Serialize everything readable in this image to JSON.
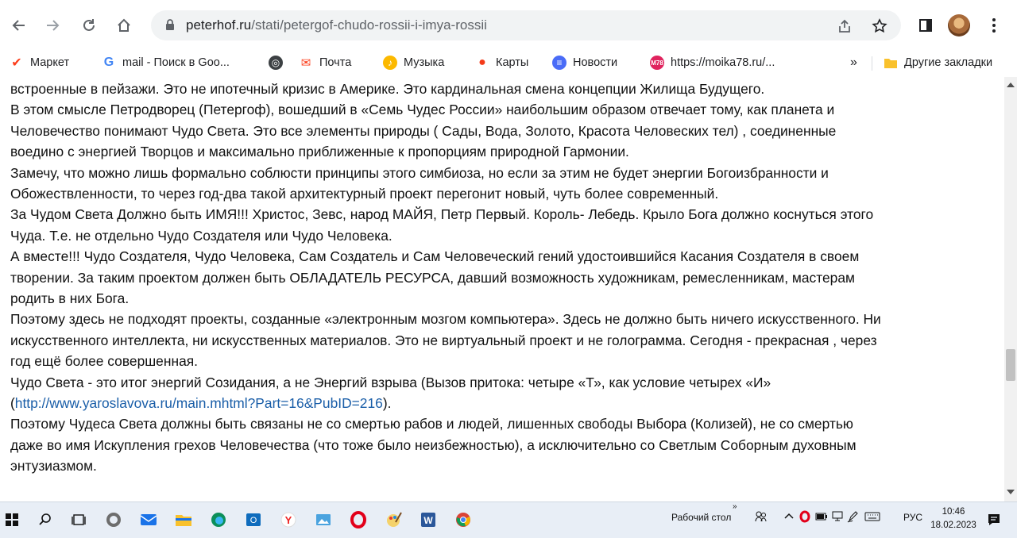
{
  "browser": {
    "url_domain": "peterhof.ru",
    "url_path": "/stati/petergof-chudo-rossii-i-imya-rossii",
    "bookmarks": [
      {
        "label": "Маркет",
        "icon": "market-icon",
        "color": "#fc3f1d"
      },
      {
        "label": "mail - Поиск в Goo...",
        "icon": "google-icon",
        "color": "#4285f4"
      },
      {
        "label": "",
        "icon": "globe-icon",
        "color": "#3c4043"
      },
      {
        "label": "Почта",
        "icon": "mail-icon",
        "color": "#fc3f1d"
      },
      {
        "label": "Музыка",
        "icon": "music-icon",
        "color": "#fcb900"
      },
      {
        "label": "Карты",
        "icon": "maps-pin-icon",
        "color": "#f43b19"
      },
      {
        "label": "Новости",
        "icon": "news-icon",
        "color": "#4a6cf7"
      },
      {
        "label": "https://moika78.ru/...",
        "icon": "moika78-icon",
        "color": "#e0245e",
        "badge": "M78"
      }
    ],
    "more_bookmarks": "»",
    "other_bookmarks": "Другие закладки"
  },
  "article": {
    "lines": [
      {
        "text": "встроенные в пейзажи. Это не ипотечный кризис в Америке. Это кардинальная смена концепции Жилища Будущего."
      },
      {
        "text": "В этом смысле Петродворец (Петергоф), вошедший в «Семь Чудес России» наибольшим образом отвечает тому, как планета и"
      },
      {
        "text": "Человечество понимают Чудо Света. Это все элементы природы ( Сады, Вода, Золото, Красота Человеских тел) , соединенные"
      },
      {
        "text": "воедино с энергией Творцов и максимально приближенные к пропорциям природной Гармонии."
      },
      {
        "text": "Замечу, что можно лишь формально соблюсти принципы этого симбиоза, но если за этим не будет энергии Богоизбранности и"
      },
      {
        "text": "Обожествленности, то через год-два такой архитектурный проект перегонит новый, чуть более современный."
      },
      {
        "text": "За Чудом Света Должно быть ИМЯ!!! Христос, Зевс, народ МАЙЯ, Петр Первый. Король- Лебедь. Крыло Бога должно коснуться этого"
      },
      {
        "text": "Чуда. Т.е. не отдельно Чудо Создателя или Чудо Человека."
      },
      {
        "text": "А вместе!!! Чудо Создателя, Чудо Человека, Сам Создатель и Сам Человеческий гений удостоившийся Касания Создателя в своем"
      },
      {
        "text": "творении. За таким проектом должен быть ОБЛАДАТЕЛЬ РЕСУРСА, давший возможность художникам, ремесленникам, мастерам"
      },
      {
        "text": "родить в них Бога."
      },
      {
        "text": "Поэтому здесь не подходят проекты, созданные «электронным мозгом компьютера». Здесь не должно быть ничего искусственного. Ни"
      },
      {
        "text": "искусственного интеллекта, ни искусственных материалов. Это не виртуальный проект и не голограмма. Сегодня - прекрасная , через"
      },
      {
        "text": "год ещё более совершенная."
      },
      {
        "text": "Чудо Света - это итог энергий Созидания, а не Энергий взрыва (Вызов притока: четыре «Т», как условие четырех «И»"
      },
      {
        "pre": "(",
        "link": "http://www.yaroslavova.ru/main.mhtml?Part=16&PubID=216",
        "post": ")."
      },
      {
        "text": "Поэтому Чудеса Света должны быть связаны не со смертью рабов и людей, лишенных свободы Выбора (Колизей), не со смертью"
      },
      {
        "text": "даже во имя Искупления грехов Человечества (что тоже было неизбежностью), а исключительно со Светлым Соборным духовным"
      },
      {
        "text": "энтузиазмом."
      }
    ]
  },
  "taskbar": {
    "desktop_label": "Рабочий стол",
    "chevron": "»",
    "language": "РУС",
    "time": "10:46",
    "date": "18.02.2023"
  }
}
